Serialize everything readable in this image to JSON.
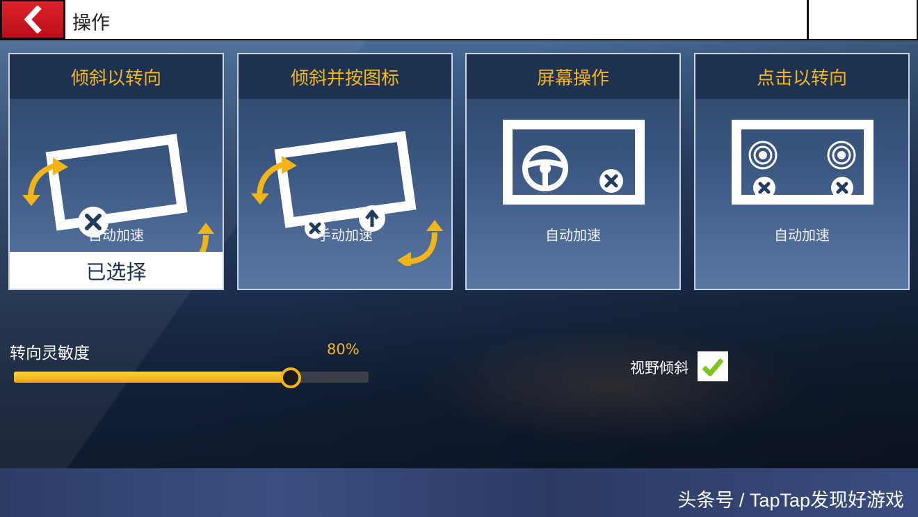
{
  "header": {
    "title": "操作"
  },
  "modes": [
    {
      "title": "倾斜以转向",
      "subtitle": "自动加速",
      "selected": true,
      "selected_label": "已选择"
    },
    {
      "title": "倾斜并按图标",
      "subtitle": "手动加速",
      "selected": false
    },
    {
      "title": "屏幕操作",
      "subtitle": "自动加速",
      "selected": false
    },
    {
      "title": "点击以转向",
      "subtitle": "自动加速",
      "selected": false
    }
  ],
  "steering_sensitivity": {
    "label": "转向灵敏度",
    "value_text": "80%",
    "value": 0.8
  },
  "view_tilt": {
    "label": "视野倾斜",
    "checked": true
  },
  "watermark": "头条号 / TapTap发现好游戏",
  "colors": {
    "accent_orange": "#f5b61e",
    "back_red": "#d51820",
    "check_green": "#7ac51e",
    "card_head": "#1d3250"
  }
}
